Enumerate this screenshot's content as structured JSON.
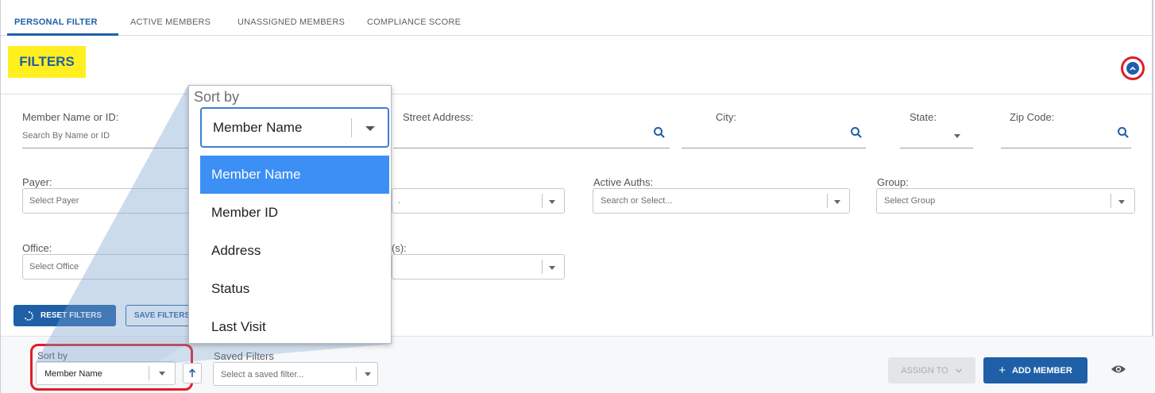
{
  "tabs": [
    {
      "label": "PERSONAL FILTER",
      "active": true
    },
    {
      "label": "ACTIVE MEMBERS",
      "active": false
    },
    {
      "label": "UNASSIGNED MEMBERS",
      "active": false
    },
    {
      "label": "COMPLIANCE SCORE",
      "active": false
    }
  ],
  "filters": {
    "title": "FILTERS",
    "collapse_icon": "chevron-up-icon",
    "member_name_or_id": {
      "label": "Member Name or ID:",
      "placeholder": "Search By Name or ID"
    },
    "street_address": {
      "label": "Street Address:"
    },
    "city": {
      "label": "City:"
    },
    "state": {
      "label": "State:"
    },
    "zip_code": {
      "label": "Zip Code:"
    },
    "payer": {
      "label": "Payer:",
      "placeholder": "Select Payer"
    },
    "active_auths": {
      "label": "Active Auths:",
      "placeholder": "Search or Select..."
    },
    "group": {
      "label": "Group:",
      "placeholder": "Select Group"
    },
    "office": {
      "label": "Office:",
      "placeholder": "Select Office"
    },
    "partial_label": "(s):",
    "partial_placeholder": "."
  },
  "actions": {
    "reset_filters": "RESET FILTERS",
    "save_filters": "SAVE FILTERS"
  },
  "bottom": {
    "sort_by": {
      "label": "Sort by",
      "value": "Member Name"
    },
    "saved_filters": {
      "label": "Saved Filters",
      "placeholder": "Select a saved filter..."
    },
    "assign_to": "ASSIGN TO",
    "add_member": "ADD MEMBER"
  },
  "zoom_dropdown": {
    "title": "Sort by",
    "selected": "Member Name",
    "options": [
      "Member Name",
      "Member ID",
      "Address",
      "Status",
      "Last Visit"
    ]
  },
  "colors": {
    "accent": "#1f5fa7",
    "highlight": "#ffef1e",
    "annotation": "#e01e26",
    "selected_option": "#3b8ff5"
  }
}
